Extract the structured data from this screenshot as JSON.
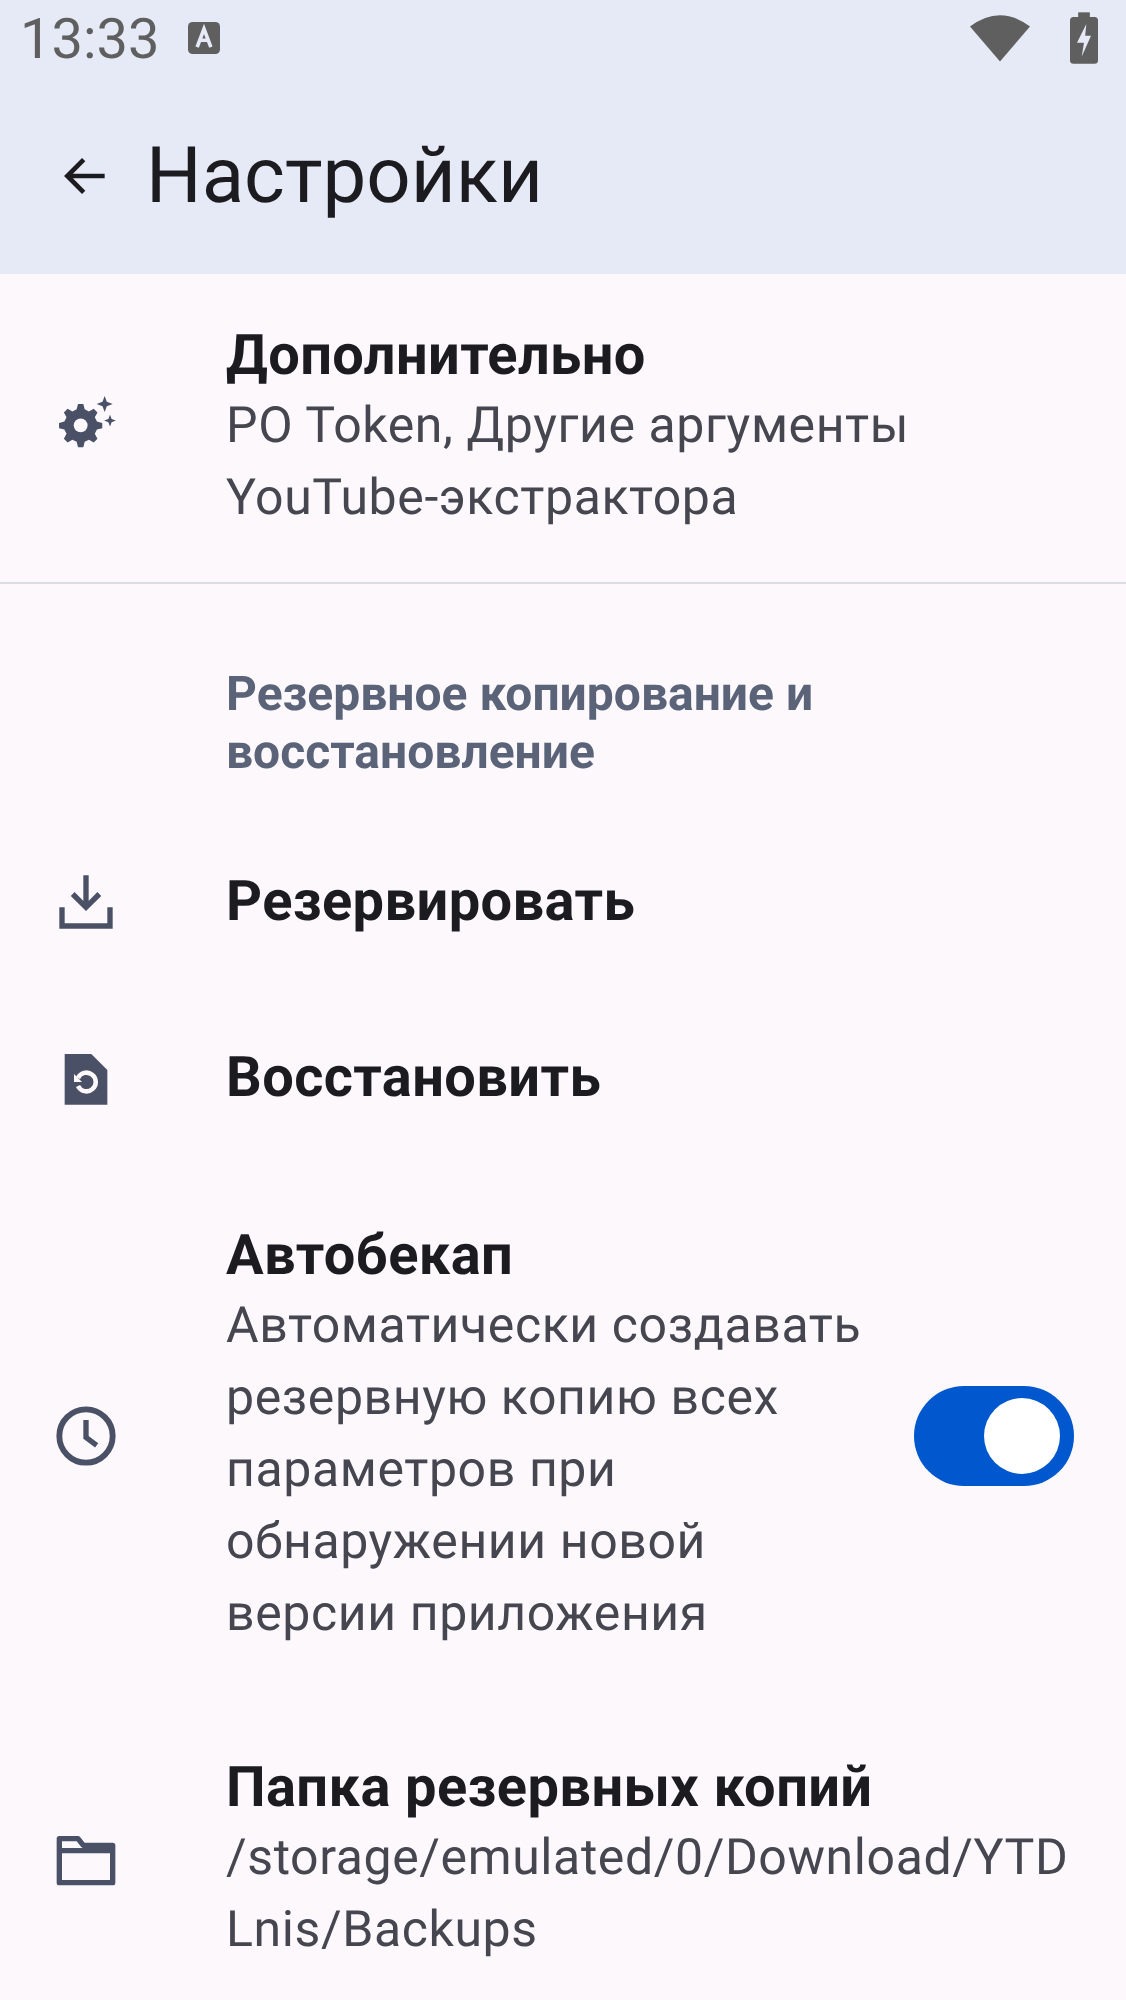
{
  "status_bar": {
    "time": "13:33"
  },
  "app_bar": {
    "title": "Настройки"
  },
  "settings": [
    {
      "kind": "item",
      "title": "Дополнительно",
      "summary": "PO Token, Другие аргументы YouTube-экстрактора"
    },
    {
      "kind": "divider"
    },
    {
      "kind": "category",
      "title": "Резервное копирование и восстановление"
    },
    {
      "kind": "item",
      "title": "Резервировать"
    },
    {
      "kind": "item",
      "title": "Восстановить"
    },
    {
      "kind": "switch",
      "title": "Автобекап",
      "summary": "Автоматически создавать резервную копию всех параметров при обнаружении новой версии приложения",
      "on": true
    },
    {
      "kind": "item",
      "title": "Папка резервных копий",
      "summary": "/storage/emulated/0/Download/YTDLnis/Backups"
    }
  ]
}
